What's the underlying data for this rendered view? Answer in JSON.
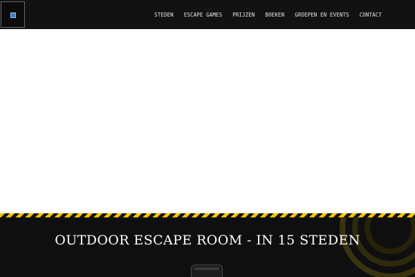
{
  "header": {
    "logo_icon": "logo-icon",
    "nav": [
      {
        "label": "STEDEN"
      },
      {
        "label": "ESCAPE GAMES"
      },
      {
        "label": "PRIJZEN"
      },
      {
        "label": "BOEKEN"
      },
      {
        "label": "GROEPEN EN EVENTS"
      },
      {
        "label": "CONTACT"
      }
    ]
  },
  "hero": {
    "title": "OUTDOOR ESCAPE ROOM - IN 15 STEDEN"
  },
  "colors": {
    "header_bg": "#121212",
    "dark_bg": "#0f0f0f",
    "hazard_yellow": "#f2c400",
    "text_light": "#ffffff"
  }
}
